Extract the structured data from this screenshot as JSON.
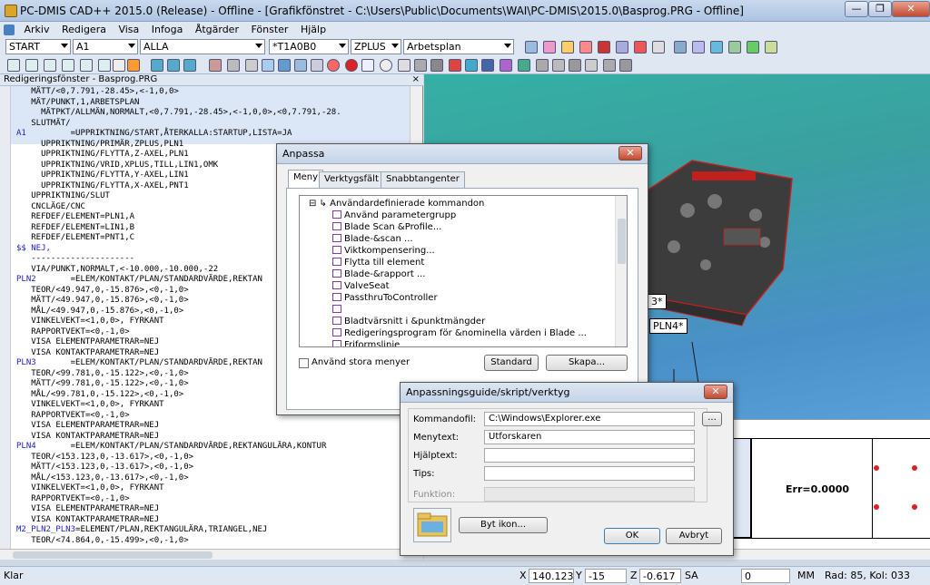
{
  "window": {
    "title": "PC-DMIS CAD++ 2015.0 (Release) - Offline - [Grafikfönstret - C:\\Users\\Public\\Documents\\WAI\\PC-DMIS\\2015.0\\Basprog.PRG - Offline]",
    "minimize": "—",
    "restore": "❐",
    "close": "✕"
  },
  "menu": {
    "items": [
      "Arkiv",
      "Redigera",
      "Visa",
      "Infoga",
      "Åtgärder",
      "Fönster",
      "Hjälp"
    ]
  },
  "toolbar": {
    "combos": [
      "START",
      "A1",
      "ALLA",
      "*T1A0B0",
      "ZPLUS",
      "Arbetsplan"
    ]
  },
  "editor": {
    "title": "Redigeringsfönster - Basprog.PRG",
    "close": "×",
    "lines": [
      {
        "l": "",
        "t": "   MÄTT/<0,7.791,-28.45>,<-1,0,0>"
      },
      {
        "l": "",
        "t": "   MÄT/PUNKT,1,ARBETSPLAN"
      },
      {
        "l": "",
        "t": "     MÄTPKT/ALLMÄN,NORMALT,<0,7.791,-28.45>,<-1,0,0>,<0,7.791,-28."
      },
      {
        "l": "",
        "t": "   SLUTMÄT/"
      },
      {
        "l": "A1",
        "t": "         =UPPRIKTNING/START,ÅTERKALLA:STARTUP,LISTA=JA"
      },
      {
        "l": "",
        "t": "     UPPRIKTNING/PRIMÄR,ZPLUS,PLN1"
      },
      {
        "l": "",
        "t": "     UPPRIKTNING/FLYTTA,Z-AXEL,PLN1"
      },
      {
        "l": "",
        "t": "     UPPRIKTNING/VRID,XPLUS,TILL,LIN1,OMK"
      },
      {
        "l": "",
        "t": "     UPPRIKTNING/FLYTTA,Y-AXEL,LIN1"
      },
      {
        "l": "",
        "t": "     UPPRIKTNING/FLYTTA,X-AXEL,PNT1"
      },
      {
        "l": "",
        "t": "   UPPRIKTNING/SLUT"
      },
      {
        "l": "",
        "t": "   CNCLÄGE/CNC"
      },
      {
        "l": "",
        "t": "   REFDEF/ELEMENT=PLN1,A"
      },
      {
        "l": "",
        "t": "   REFDEF/ELEMENT=LIN1,B"
      },
      {
        "l": "",
        "t": "   REFDEF/ELEMENT=PNT1,C"
      },
      {
        "l": "$$ NEJ,",
        "t": ""
      },
      {
        "l": "",
        "t": "   ---------------------"
      },
      {
        "l": "",
        "t": "   VIA/PUNKT,NORMALT,<-10.000,-10.000,-22"
      },
      {
        "l": "PLN2",
        "t": "       =ELEM/KONTAKT/PLAN/STANDARDVÄRDE,REKTAN"
      },
      {
        "l": "",
        "t": "   TEOR/<49.947,0,-15.876>,<0,-1,0>"
      },
      {
        "l": "",
        "t": "   MÄTT/<49.947,0,-15.876>,<0,-1,0>"
      },
      {
        "l": "",
        "t": "   MÅL/<49.947,0,-15.876>,<0,-1,0>"
      },
      {
        "l": "",
        "t": "   VINKELVEKT=<1,0,0>, FYRKANT"
      },
      {
        "l": "",
        "t": "   RAPPORTVEKT=<0,-1,0>"
      },
      {
        "l": "",
        "t": "   VISA ELEMENTPARAMETRAR=NEJ"
      },
      {
        "l": "",
        "t": "   VISA KONTAKTPARAMETRAR=NEJ"
      },
      {
        "l": "PLN3",
        "t": "       =ELEM/KONTAKT/PLAN/STANDARDVÄRDE,REKTAN"
      },
      {
        "l": "",
        "t": "   TEOR/<99.781,0,-15.122>,<0,-1,0>"
      },
      {
        "l": "",
        "t": "   MÄTT/<99.781,0,-15.122>,<0,-1,0>"
      },
      {
        "l": "",
        "t": "   MÅL/<99.781,0,-15.122>,<0,-1,0>"
      },
      {
        "l": "",
        "t": "   VINKELVEKT=<1,0,0>, FYRKANT"
      },
      {
        "l": "",
        "t": "   RAPPORTVEKT=<0,-1,0>"
      },
      {
        "l": "",
        "t": "   VISA ELEMENTPARAMETRAR=NEJ"
      },
      {
        "l": "",
        "t": "   VISA KONTAKTPARAMETRAR=NEJ"
      },
      {
        "l": "PLN4",
        "t": "       =ELEM/KONTAKT/PLAN/STANDARDVÄRDE,REKTANGULÄRA,KONTUR"
      },
      {
        "l": "",
        "t": "   TEOR/<153.123,0,-13.617>,<0,-1,0>"
      },
      {
        "l": "",
        "t": "   MÄTT/<153.123,0,-13.617>,<0,-1,0>"
      },
      {
        "l": "",
        "t": "   MÅL/<153.123,0,-13.617>,<0,-1,0>"
      },
      {
        "l": "",
        "t": "   VINKELVEKT=<1,0,0>, FYRKANT"
      },
      {
        "l": "",
        "t": "   RAPPORTVEKT=<0,-1,0>"
      },
      {
        "l": "",
        "t": "   VISA ELEMENTPARAMETRAR=NEJ"
      },
      {
        "l": "",
        "t": "   VISA KONTAKTPARAMETRAR=NEJ"
      },
      {
        "l": "M2_PLN2_PLN3",
        "t": "=ELEMENT/PLAN,REKTANGULÄRA,TRIANGEL,NEJ"
      },
      {
        "l": "",
        "t": "   TEOR/<74.864,0,-15.499>,<0,-1,0>"
      }
    ]
  },
  "viewport": {
    "labels": [
      "3*",
      "PLN4*"
    ],
    "err_text": "Err=0.0000"
  },
  "anpassa": {
    "title": "Anpassa",
    "tabs": [
      "Meny",
      "Verktygsfält",
      "Snabbtangenter"
    ],
    "tree_root": "Användardefinierade kommandon",
    "tree_items": [
      "Använd parametergrupp",
      "Blade Scan &Profile...",
      "Blade-&scan ...",
      "Viktkompensering...",
      "Flytta till element",
      "Blade-&rapport ...",
      "ValveSeat",
      "PassthruToController",
      "",
      "Bladtvärsnitt i &punktmängder",
      "Redigeringsprogram för &nominella värden i Blade ...",
      "Friformslinje"
    ],
    "checkbox_label": "Använd stora menyer",
    "standard_btn": "Standard",
    "skapa_btn": "Skapa..."
  },
  "guide": {
    "title": "Anpassningsguide/skript/verktyg",
    "fields": [
      {
        "label": "Kommandofil:",
        "value": "C:\\Windows\\Explorer.exe"
      },
      {
        "label": "Menytext:",
        "value": "Utforskaren"
      },
      {
        "label": "Hjälptext:",
        "value": ""
      },
      {
        "label": "Tips:",
        "value": ""
      },
      {
        "label": "Funktion:",
        "value": ""
      }
    ],
    "browse_btn": "...",
    "change_icon_btn": "Byt ikon...",
    "ok_btn": "OK",
    "cancel_btn": "Avbryt"
  },
  "status": {
    "ready": "Klar",
    "x_label": "X",
    "x_value": "140.123",
    "y_label": "Y",
    "y_value": "-15",
    "z_label": "Z",
    "z_value": "-0.617",
    "sa": "SA",
    "zero": "0",
    "unit": "MM",
    "position": "Rad: 85, Kol: 033"
  }
}
